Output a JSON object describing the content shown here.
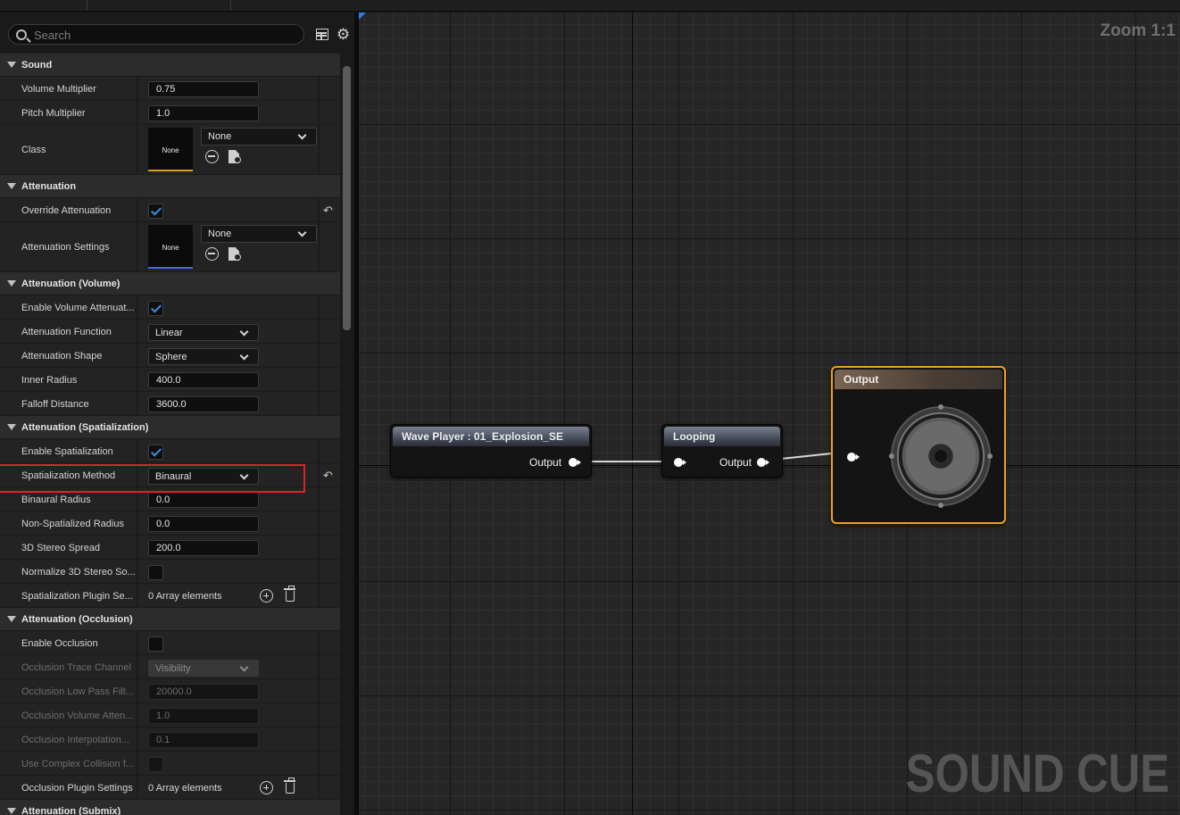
{
  "search": {
    "placeholder": "Search"
  },
  "categories": {
    "sound": "Sound",
    "attenuation": "Attenuation",
    "volume": "Attenuation (Volume)",
    "spatialization": "Attenuation (Spatialization)",
    "occlusion": "Attenuation (Occlusion)",
    "submix": "Attenuation (Submix)"
  },
  "sound": {
    "volume_multiplier": {
      "label": "Volume Multiplier",
      "value": "0.75"
    },
    "pitch_multiplier": {
      "label": "Pitch Multiplier",
      "value": "1.0"
    },
    "class": {
      "label": "Class",
      "thumb": "None",
      "value": "None"
    }
  },
  "attenuation": {
    "override": {
      "label": "Override Attenuation",
      "checked": true
    },
    "settings": {
      "label": "Attenuation Settings",
      "thumb": "None",
      "value": "None"
    }
  },
  "volume": {
    "enable": {
      "label": "Enable Volume Attenuat...",
      "checked": true
    },
    "function": {
      "label": "Attenuation Function",
      "value": "Linear"
    },
    "shape": {
      "label": "Attenuation Shape",
      "value": "Sphere"
    },
    "inner_radius": {
      "label": "Inner Radius",
      "value": "400.0"
    },
    "falloff": {
      "label": "Falloff Distance",
      "value": "3600.0"
    }
  },
  "spatialization": {
    "enable": {
      "label": "Enable Spatialization",
      "checked": true
    },
    "method": {
      "label": "Spatialization Method",
      "value": "Binaural"
    },
    "binaural_radius": {
      "label": "Binaural Radius",
      "value": "0.0"
    },
    "non_spatialized_radius": {
      "label": "Non-Spatialized Radius",
      "value": "0.0"
    },
    "stereo_spread": {
      "label": "3D Stereo Spread",
      "value": "200.0"
    },
    "normalize": {
      "label": "Normalize 3D Stereo So...",
      "checked": false
    },
    "plugin_settings": {
      "label": "Spatialization Plugin Se...",
      "value": "0 Array elements"
    }
  },
  "occlusion": {
    "enable": {
      "label": "Enable Occlusion",
      "checked": false
    },
    "trace_channel": {
      "label": "Occlusion Trace Channel",
      "value": "Visibility"
    },
    "low_pass": {
      "label": "Occlusion Low Pass Filt...",
      "value": "20000.0"
    },
    "volume_atten": {
      "label": "Occlusion Volume Atten...",
      "value": "1.0"
    },
    "interpolation": {
      "label": "Occlusion Interpolation...",
      "value": "0.1"
    },
    "complex_collision": {
      "label": "Use Complex Collision f...",
      "checked": false
    },
    "plugin_settings": {
      "label": "Occlusion Plugin Settings",
      "value": "0 Array elements"
    }
  },
  "graph": {
    "zoom": "Zoom 1:1",
    "watermark": "SOUND CUE",
    "wave_player": {
      "title": "Wave Player : 01_Explosion_SE",
      "output": "Output"
    },
    "looping": {
      "title": "Looping",
      "output": "Output"
    },
    "output_node": {
      "title": "Output"
    }
  },
  "colors": {
    "accent_check": "#3a8fe8",
    "highlight_box": "#d8242a",
    "output_border": "#f0a020",
    "class_thumb_bar": "#d7a01c",
    "attenuation_thumb_bar": "#4d68d6"
  }
}
